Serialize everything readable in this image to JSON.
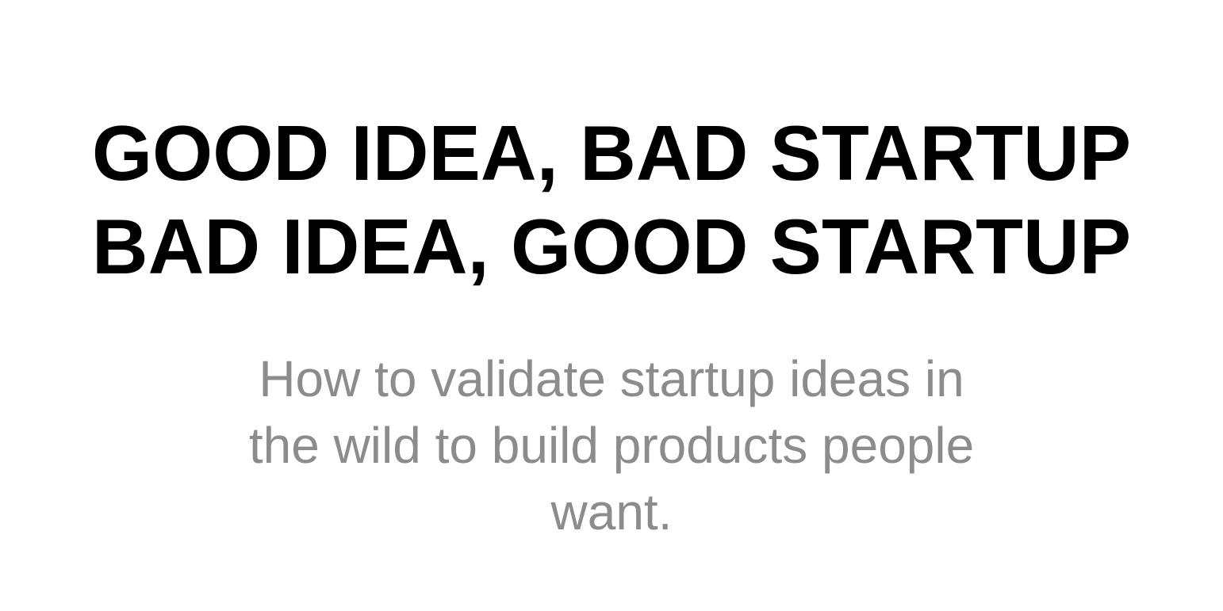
{
  "slide": {
    "title_lines": [
      "GOOD IDEA, BAD STARTUP",
      "BAD IDEA, GOOD STARTUP"
    ],
    "subtitle_lines": [
      "How to validate startup ideas in",
      "the wild to build products people",
      "want."
    ]
  },
  "colors": {
    "background": "#ffffff",
    "title": "#000000",
    "subtitle": "#8c8c8c"
  }
}
